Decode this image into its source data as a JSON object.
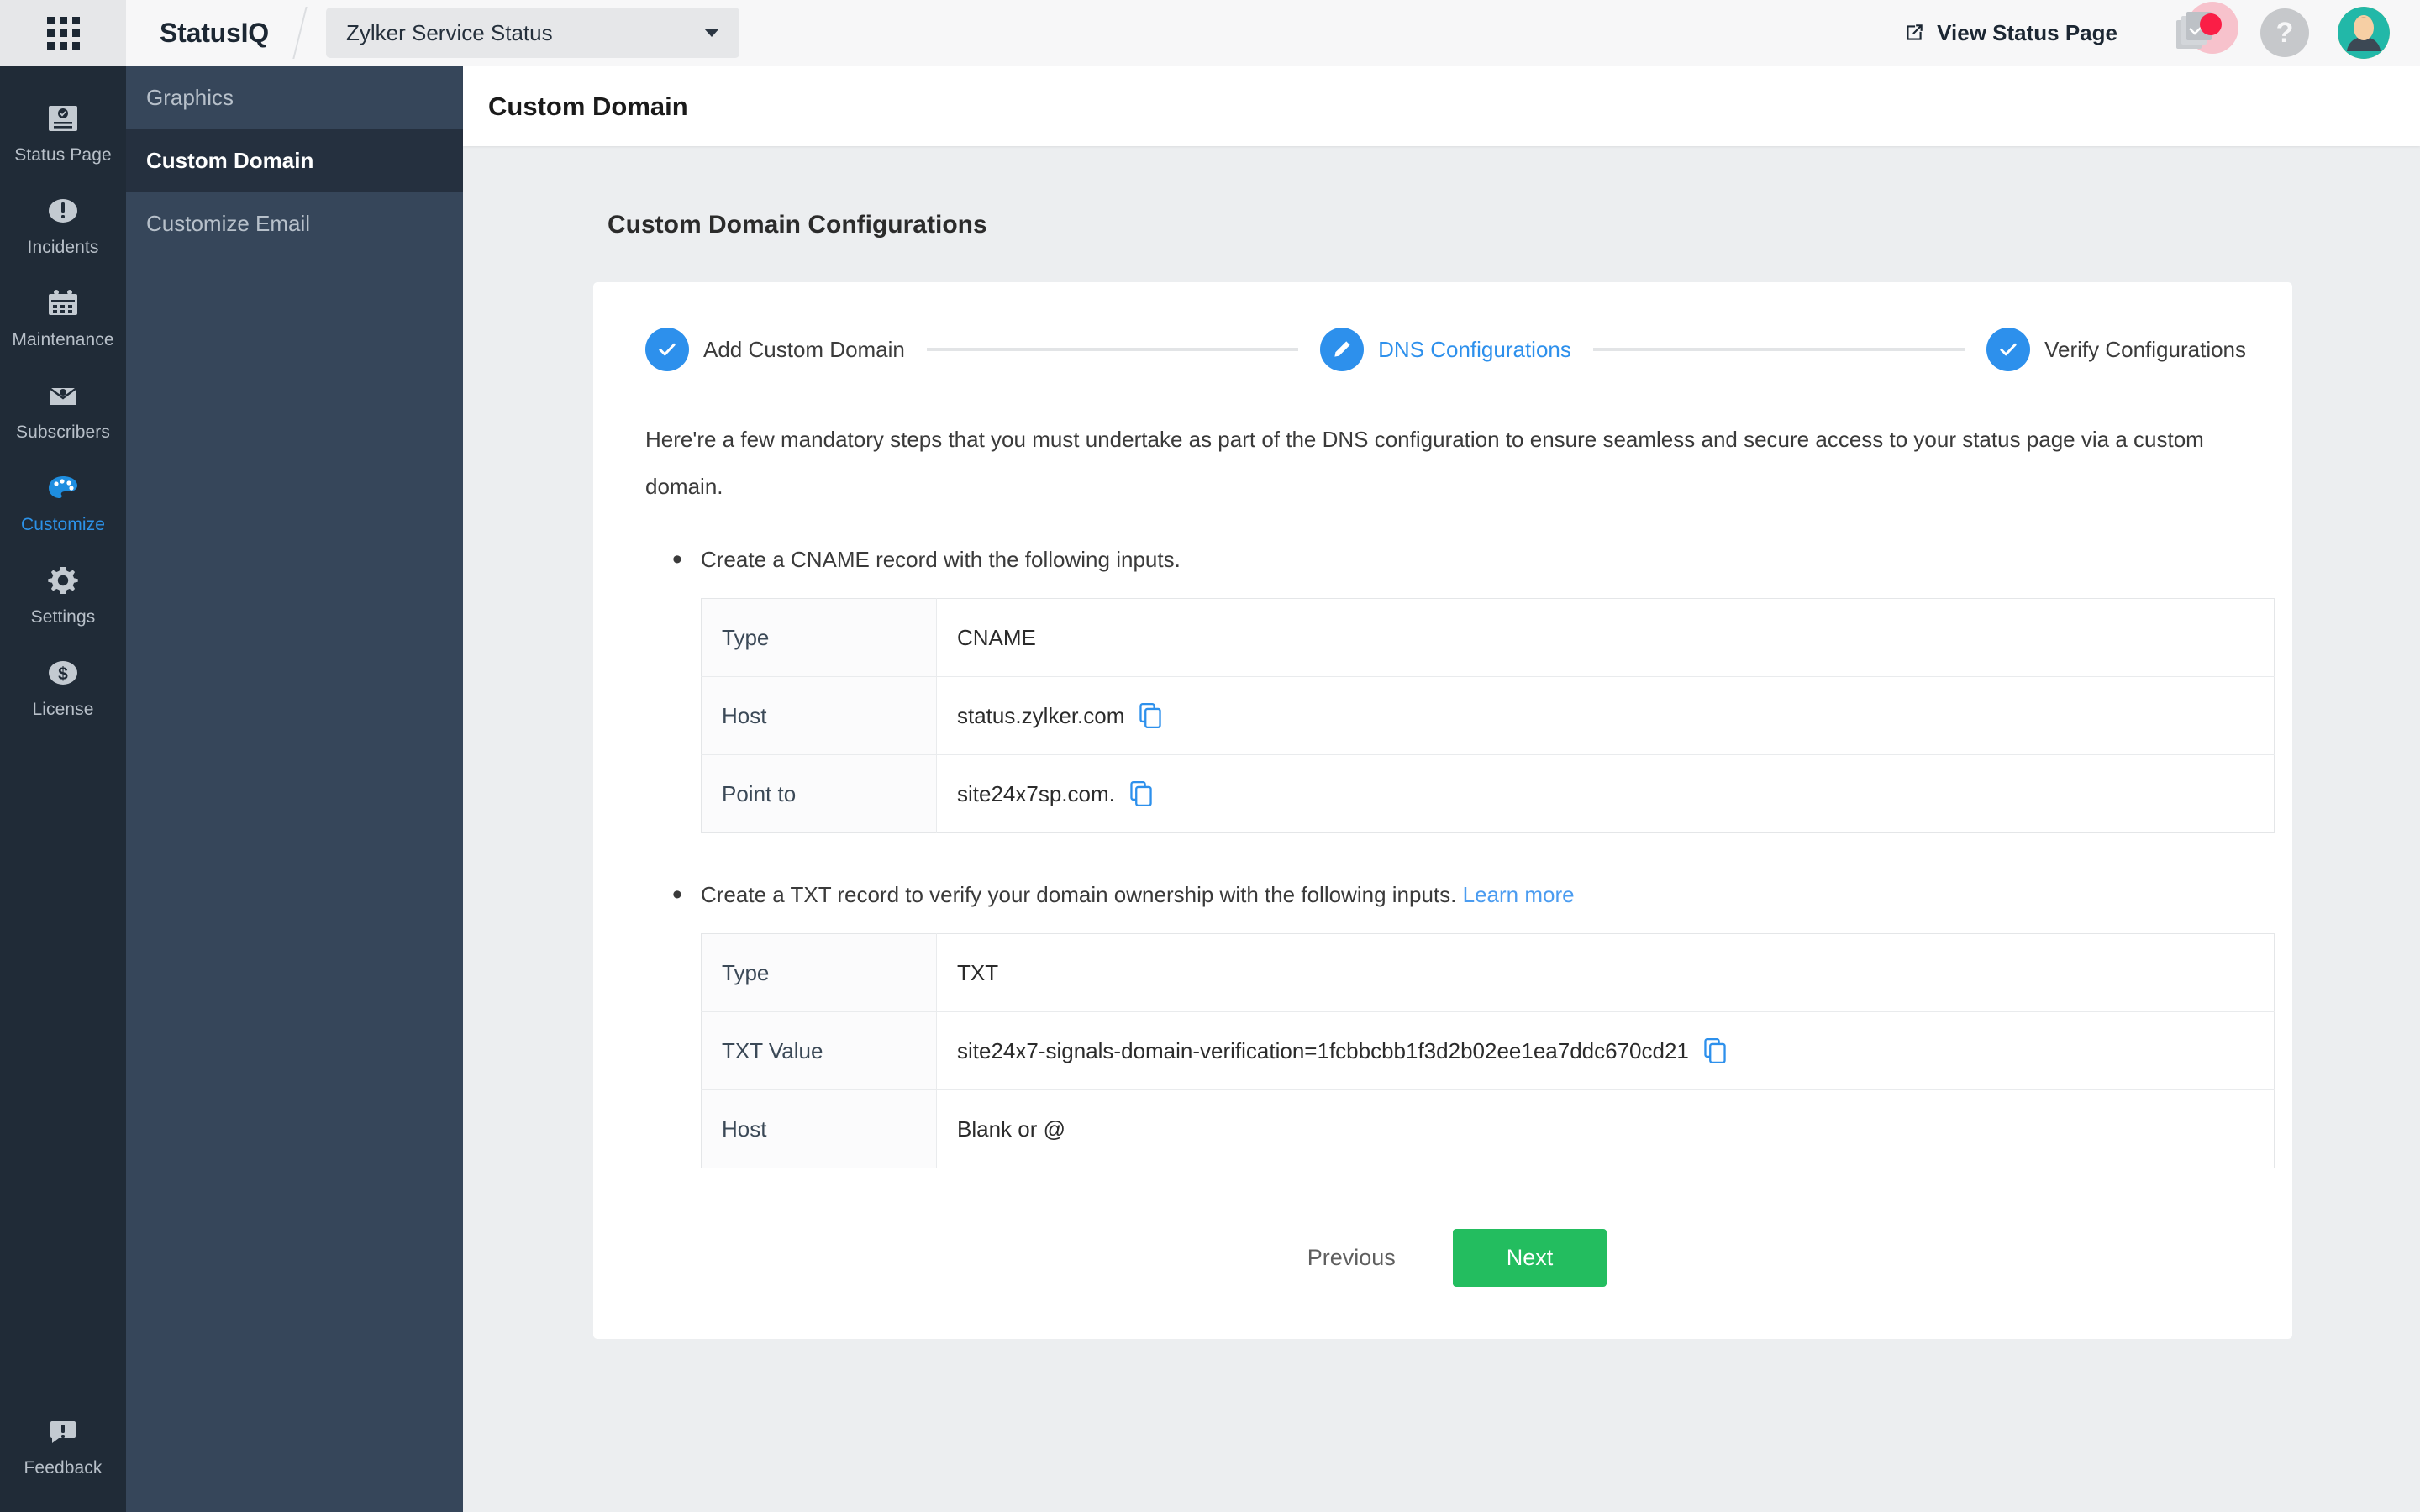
{
  "header": {
    "apps_icon": "grid-apps-icon",
    "brand": "StatusIQ",
    "site_selector": {
      "value": "Zylker Service Status",
      "caret_icon": "chevron-down-icon"
    },
    "view_status_page": "View Status Page",
    "view_status_icon": "external-link-icon",
    "notifications_icon": "notifications-icon",
    "help_icon": "help-question-icon",
    "avatar_icon": "user-avatar"
  },
  "rail": {
    "items": [
      {
        "label": "Status Page",
        "icon": "status-page-icon",
        "active": false
      },
      {
        "label": "Incidents",
        "icon": "incidents-icon",
        "active": false
      },
      {
        "label": "Maintenance",
        "icon": "maintenance-calendar-icon",
        "active": false
      },
      {
        "label": "Subscribers",
        "icon": "subscribers-mail-icon",
        "active": false
      },
      {
        "label": "Customize",
        "icon": "customize-palette-icon",
        "active": true
      },
      {
        "label": "Settings",
        "icon": "settings-gear-icon",
        "active": false
      },
      {
        "label": "License",
        "icon": "license-dollar-icon",
        "active": false
      }
    ],
    "bottom": {
      "label": "Feedback",
      "icon": "feedback-icon"
    }
  },
  "subnav": {
    "items": [
      {
        "label": "Graphics",
        "active": false
      },
      {
        "label": "Custom Domain",
        "active": true
      },
      {
        "label": "Customize Email",
        "active": false
      }
    ]
  },
  "page": {
    "title": "Custom Domain",
    "section_title": "Custom Domain Configurations"
  },
  "stepper": {
    "steps": [
      {
        "label": "Add Custom Domain",
        "icon": "check-icon",
        "state": "done"
      },
      {
        "label": "DNS Configurations",
        "icon": "pencil-icon",
        "state": "current"
      },
      {
        "label": "Verify Configurations",
        "icon": "check-icon",
        "state": "done"
      }
    ]
  },
  "body": {
    "intro": "Here're a few mandatory steps that you must undertake as part of the DNS configuration to ensure seamless and secure access to your status page via a custom domain.",
    "bullet1": "Create a CNAME record with the following inputs.",
    "bullet2": "Create a TXT record to verify your domain ownership with the following inputs.",
    "learn_more": "Learn more"
  },
  "cname_table": {
    "rows": [
      {
        "key": "Type",
        "value": "CNAME",
        "copy": false
      },
      {
        "key": "Host",
        "value": "status.zylker.com",
        "copy": true
      },
      {
        "key": "Point to",
        "value": "site24x7sp.com.",
        "copy": true
      }
    ]
  },
  "txt_table": {
    "rows": [
      {
        "key": "Type",
        "value": "TXT",
        "copy": false
      },
      {
        "key": "TXT Value",
        "value": "site24x7-signals-domain-verification=1fcbbcbb1f3d2b02ee1ea7ddc670cd21",
        "copy": true
      },
      {
        "key": "Host",
        "value": "Blank or @",
        "copy": false
      }
    ]
  },
  "actions": {
    "previous": "Previous",
    "next": "Next"
  },
  "colors": {
    "accent_blue": "#2d90ec",
    "success_green": "#23bd5f",
    "rail_bg": "#202b37",
    "subnav_bg": "#36465a",
    "subnav_active_bg": "#25303f",
    "link_blue": "#4b9cf0",
    "badge_red": "#fa1e46"
  }
}
